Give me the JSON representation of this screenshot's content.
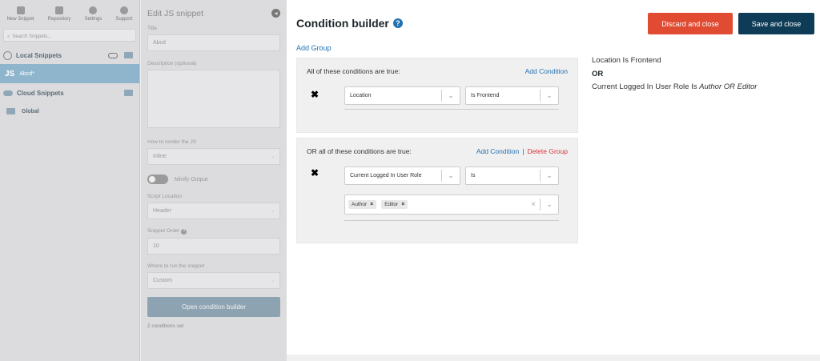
{
  "sidebar": {
    "nav": [
      {
        "label": "New Snippet",
        "icon": "new-snippet-icon"
      },
      {
        "label": "Repository",
        "icon": "repository-icon"
      },
      {
        "label": "Settings",
        "icon": "gear-icon"
      },
      {
        "label": "Support",
        "icon": "help-icon"
      }
    ],
    "search_placeholder": "Search Snippets...",
    "local_label": "Local Snippets",
    "active_snippet": {
      "badge": "JS",
      "name": "Abcd*"
    },
    "cloud_label": "Cloud Snippets",
    "folder_label": "Global"
  },
  "editor": {
    "title": "Edit JS snippet",
    "title_label": "Title",
    "title_value": "Abcd",
    "description_label": "Description (optional)",
    "render_label": "How to render the JS",
    "render_value": "Inline",
    "minify_label": "Minify Output",
    "location_label": "Script Location",
    "location_value": "Header",
    "order_label": "Snippet Order",
    "order_value": "10",
    "where_label": "Where to run the snippet",
    "where_value": "Custom",
    "open_builder": "Open condition builder",
    "conditions_set": "2 conditions set"
  },
  "modal": {
    "title": "Condition builder",
    "discard": "Discard and close",
    "save": "Save and close",
    "add_group": "Add Group",
    "colors": {
      "discard": "#e04b32",
      "save": "#0e3b55",
      "link": "#2271b1",
      "delete": "#d63638"
    },
    "group1": {
      "heading": "All of these conditions are true:",
      "add_condition": "Add Condition",
      "field": "Location",
      "operator": "Is Frontend"
    },
    "group2": {
      "heading": "OR all of these conditions are true:",
      "add_condition": "Add Condition",
      "separator": "|",
      "delete_group": "Delete Group",
      "field": "Current Logged In User Role",
      "operator": "Is",
      "tags": [
        "Author",
        "Editor"
      ]
    },
    "summary": {
      "line1": "Location Is Frontend",
      "or": "OR",
      "line3_prefix": "Current Logged In User Role Is ",
      "line3_value": "Author OR Editor"
    }
  }
}
